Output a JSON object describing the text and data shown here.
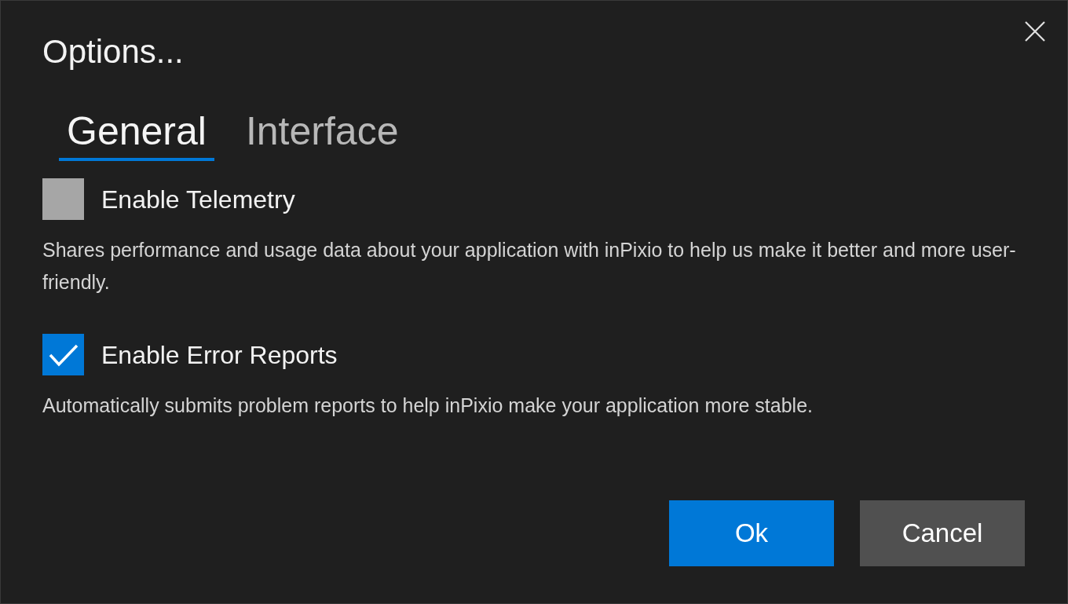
{
  "window": {
    "title": "Options..."
  },
  "tabs": [
    {
      "label": "General",
      "selected": true
    },
    {
      "label": "Interface",
      "selected": false
    }
  ],
  "options": [
    {
      "label": "Enable Telemetry",
      "checked": false,
      "description": "Shares performance and usage data about your application with inPixio to help us make it better and more user-friendly."
    },
    {
      "label": "Enable Error Reports",
      "checked": true,
      "description": "Automatically submits problem reports to help inPixio make your application more stable."
    }
  ],
  "buttons": [
    {
      "label": "Ok",
      "kind": "primary"
    },
    {
      "label": "Cancel",
      "kind": "secondary"
    }
  ]
}
